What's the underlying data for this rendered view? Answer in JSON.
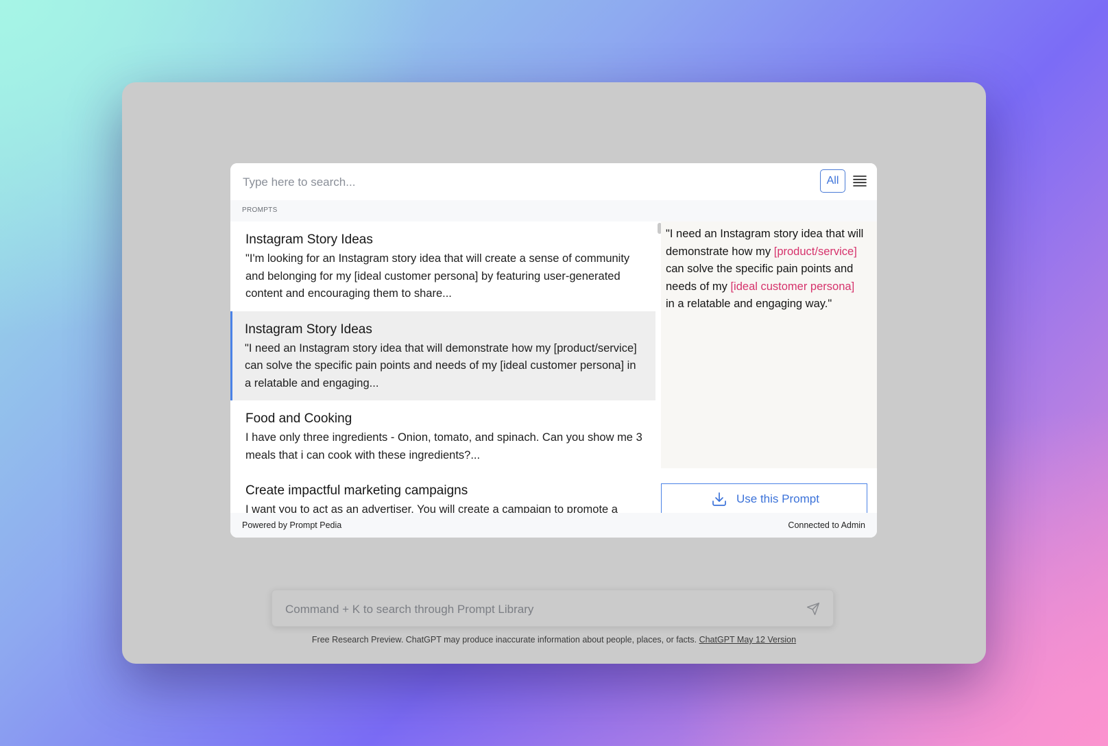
{
  "search": {
    "placeholder": "Type here to search..."
  },
  "filter": {
    "all_label": "All"
  },
  "icons": {
    "menu": "hamburger-menu-icon",
    "download": "download-icon",
    "send": "send-icon"
  },
  "section": {
    "label": "PROMPTS"
  },
  "prompts": [
    {
      "title": "Instagram Story Ideas",
      "description": "\"I'm looking for an Instagram story idea that will create a sense of community and belonging for my [ideal customer persona] by featuring user-generated content and encouraging them to share..."
    },
    {
      "title": "Instagram Story Ideas",
      "description": "\"I need an Instagram story idea that will demonstrate how my [product/service] can solve the specific pain points and needs of my [ideal customer persona] in a relatable and engaging..."
    },
    {
      "title": "Food and Cooking",
      "description": "I have only three ingredients - Onion, tomato, and spinach. Can you show me 3 meals that i can cook with these ingredients?..."
    },
    {
      "title": "Create impactful marketing campaigns",
      "description": "I want you to act as an advertiser. You will create a campaign to promote a"
    }
  ],
  "selected_index": 1,
  "preview": {
    "parts": [
      "\"I need an Instagram story idea that will demonstrate how my ",
      "[product/service]",
      " can solve the specific pain points and needs of my ",
      "[ideal customer persona]",
      " in a relatable and engaging way.\""
    ]
  },
  "use_button": {
    "label": "Use this Prompt"
  },
  "footer": {
    "powered_by": "Powered by Prompt Pedia",
    "connection": "Connected to Admin"
  },
  "command_bar": {
    "placeholder": "Command + K to search through Prompt Library"
  },
  "disclaimer": {
    "text": "Free Research Preview. ChatGPT may produce inaccurate information about people, places, or facts. ",
    "link": "ChatGPT May 12 Version"
  },
  "colors": {
    "accent": "#3b72d9",
    "variable": "#d6336c",
    "selected_row": "#eeeeee"
  }
}
